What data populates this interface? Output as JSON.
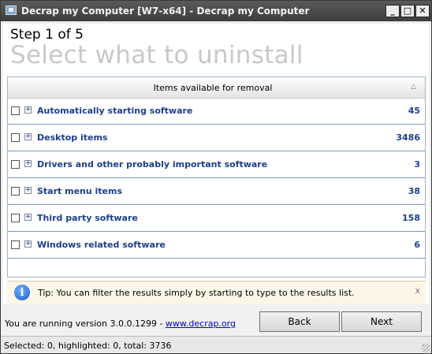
{
  "window": {
    "title": "Decrap my Computer [W7-x64] - Decrap my Computer",
    "minimize": "_",
    "maximize": "□",
    "close": "✕"
  },
  "header": {
    "step": "Step 1 of 5",
    "title": "Select what to uninstall"
  },
  "list": {
    "column_header": "Items available for removal",
    "sort_indicator": "△",
    "items": [
      {
        "label": "Automatically starting software",
        "count": "45"
      },
      {
        "label": "Desktop items",
        "count": "3486"
      },
      {
        "label": "Drivers and other probably important software",
        "count": "3"
      },
      {
        "label": "Start menu items",
        "count": "38"
      },
      {
        "label": "Third party software",
        "count": "158"
      },
      {
        "label": "Windows related software",
        "count": "6"
      }
    ]
  },
  "tip": {
    "text": "Tip: You can filter the results simply by starting to type to the results list.",
    "close": "x",
    "icon": "info-icon"
  },
  "footer": {
    "version_text": "You are running version 3.0.0.1299 - ",
    "link_text": "www.decrap.org",
    "back_label": "Back",
    "next_label": "Next"
  },
  "status": {
    "text": "Selected: 0, highlighted: 0, total: 3736"
  }
}
